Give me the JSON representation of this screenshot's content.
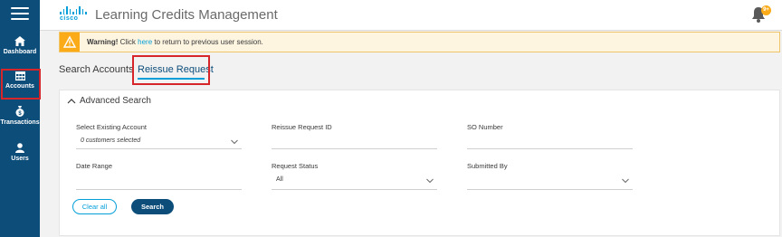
{
  "app": {
    "title": "Learning Credits Management",
    "logo_text": "cisco",
    "bell_badge": "9+"
  },
  "sidebar": {
    "items": [
      {
        "label": "Dashboard",
        "icon": "home-icon"
      },
      {
        "label": "Accounts",
        "icon": "grid-icon",
        "highlighted": true
      },
      {
        "label": "Transactions",
        "icon": "money-bag-icon"
      },
      {
        "label": "Users",
        "icon": "user-icon"
      }
    ]
  },
  "warning": {
    "bold": "Warning!",
    "pre": " Click ",
    "link": "here",
    "post": " to return to previous user session."
  },
  "tabs": [
    {
      "label": "Search Accounts",
      "active": false
    },
    {
      "label": "Reissue Request",
      "active": true
    }
  ],
  "advanced_search": {
    "title": "Advanced Search",
    "fields": {
      "existing_account": {
        "label": "Select Existing Account",
        "value": "0 customers selected"
      },
      "reissue_id": {
        "label": "Reissue Request ID",
        "value": ""
      },
      "so_number": {
        "label": "SO Number",
        "value": ""
      },
      "date_range": {
        "label": "Date Range",
        "value": ""
      },
      "request_status": {
        "label": "Request Status",
        "value": "All"
      },
      "submitted_by": {
        "label": "Submitted By",
        "value": ""
      }
    },
    "clear_label": "Clear all",
    "search_label": "Search"
  },
  "colors": {
    "sidebar": "#0c4d7a",
    "accent": "#049fd9",
    "warning": "#fbab18",
    "highlight": "#d7262a"
  }
}
